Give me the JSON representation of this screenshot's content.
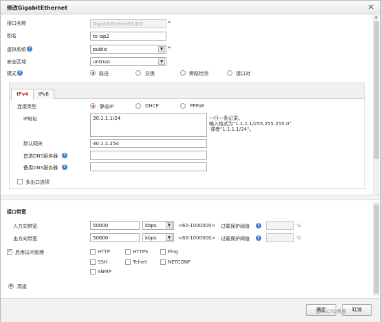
{
  "dialog": {
    "title": "修改GigabitEthernet",
    "close_glyph": "✕"
  },
  "form": {
    "interface_name": {
      "label": "接口名称",
      "value": "GigabitEthernet1/0/2",
      "required": "*"
    },
    "alias": {
      "label": "别名",
      "value": "to isp2"
    },
    "vsys": {
      "label": "虚拟系统",
      "value": "public",
      "required": "*"
    },
    "zone": {
      "label": "安全区域",
      "value": "untrust"
    },
    "mode": {
      "label": "模式",
      "options": [
        "路由",
        "交换",
        "旁路检测",
        "接口对"
      ],
      "selected": "路由"
    }
  },
  "tabs": [
    {
      "label": "IPv4",
      "active": true
    },
    {
      "label": "IPv6",
      "active": false
    }
  ],
  "ipv4": {
    "conn_type": {
      "label": "连接类型",
      "options": [
        "静态IP",
        "DHCP",
        "PPPoE"
      ],
      "selected": "静态IP"
    },
    "ip": {
      "label": "IP地址",
      "value": "30.1.1.1/24"
    },
    "ip_hint": [
      "一行一条记录。",
      "输入格式为\"1.1.1.1/255.255.255.0\"",
      "或者\"1.1.1.1/24\"。"
    ],
    "gateway": {
      "label": "默认网关",
      "value": "30.1.1.254"
    },
    "dns1": {
      "label": "首选DNS服务器",
      "value": ""
    },
    "dns2": {
      "label": "备用DNS服务器",
      "value": ""
    },
    "multi_exit": {
      "label": "多出口选项",
      "checked": false
    }
  },
  "bandwidth": {
    "section_title": "接口带宽",
    "inbound": {
      "label": "入方向带宽",
      "value": "50000",
      "unit": "kbps",
      "range": "<60-1000000>",
      "protect_label": "过载保护阈值",
      "percent": "%"
    },
    "outbound": {
      "label": "出方向带宽",
      "value": "50000",
      "unit": "kbps",
      "range": "<60-1000000>",
      "protect_label": "过载保护阈值",
      "percent": "%"
    }
  },
  "access": {
    "label": "启用访问管理",
    "checked": true,
    "services": [
      "HTTP",
      "HTTPS",
      "Ping",
      "SSH",
      "Telnet",
      "NETCONF",
      "SNMP"
    ]
  },
  "advanced": {
    "label": "高级"
  },
  "footer": {
    "ok": "确定",
    "cancel": "取消",
    "watermark": "@51CTO博客"
  },
  "colors": {
    "accent": "#c92a2a",
    "help": "#3f7fcf"
  }
}
